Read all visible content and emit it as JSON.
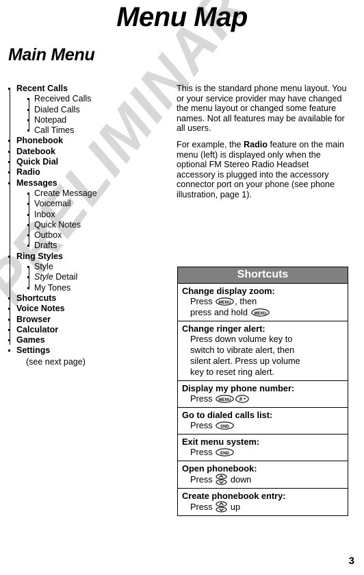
{
  "document": {
    "title": "Menu Map",
    "section_title": "Main Menu",
    "watermark": "PRELIMINARY",
    "page_number": "3"
  },
  "menu_tree": {
    "items": [
      {
        "label": "Recent Calls",
        "children": [
          {
            "label": "Received Calls"
          },
          {
            "label": "Dialed Calls"
          },
          {
            "label": "Notepad"
          },
          {
            "label": "Call Times"
          }
        ]
      },
      {
        "label": "Phonebook",
        "children": []
      },
      {
        "label": "Datebook",
        "children": []
      },
      {
        "label": "Quick Dial",
        "children": []
      },
      {
        "label": "Radio",
        "children": []
      },
      {
        "label": "Messages",
        "children": [
          {
            "label": "Create Message"
          },
          {
            "label": "Voicemail"
          },
          {
            "label": "Inbox"
          },
          {
            "label": "Quick Notes"
          },
          {
            "label": "Outbox"
          },
          {
            "label": "Drafts"
          }
        ]
      },
      {
        "label": "Ring Styles",
        "children": [
          {
            "label": "Style"
          },
          {
            "label": "Style Detail",
            "italic_prefix": "Style",
            "rest": " Detail"
          },
          {
            "label": "My Tones"
          }
        ]
      },
      {
        "label": "Shortcuts",
        "children": []
      },
      {
        "label": "Voice Notes",
        "children": []
      },
      {
        "label": "Browser",
        "children": []
      },
      {
        "label": "Calculator",
        "children": []
      },
      {
        "label": "Games",
        "children": []
      },
      {
        "label": "Settings",
        "children": []
      }
    ],
    "note": "(see next page)"
  },
  "body": {
    "paragraph1": "This is the standard phone menu layout. You or your service provider may have changed the menu layout or changed some feature names. Not all features may be available for all users.",
    "paragraph2_before": "For example, the ",
    "paragraph2_bold": "Radio",
    "paragraph2_after": " feature on the main menu (left) is displayed only when the optional FM Stereo Radio Headset accessory is plugged into the accessory connector port on your phone (see phone illustration, page 1)."
  },
  "shortcuts": {
    "header": "Shortcuts",
    "header_bg": "#808080",
    "header_text_color": "#ffffff",
    "rows": [
      {
        "title": "Change display zoom:",
        "lines": [
          {
            "pre": "Press ",
            "key": "menu-key",
            "post": ", then"
          },
          {
            "pre": "press and hold ",
            "key": "menu-key",
            "post": ""
          }
        ]
      },
      {
        "title": "Change ringer alert:",
        "lines": [
          {
            "pre": "Press down volume key to",
            "key": "",
            "post": ""
          },
          {
            "pre": "switch to vibrate alert, then",
            "key": "",
            "post": ""
          },
          {
            "pre": "silent alert. Press up volume",
            "key": "",
            "post": ""
          },
          {
            "pre": "key to reset ring alert.",
            "key": "",
            "post": ""
          }
        ]
      },
      {
        "title": "Display my phone number:",
        "lines": [
          {
            "pre": "Press ",
            "key": "menu-key",
            "key2": "pound-key",
            "post": ""
          }
        ]
      },
      {
        "title": "Go to dialed calls list:",
        "lines": [
          {
            "pre": "Press ",
            "key": "send-key",
            "post": ""
          }
        ]
      },
      {
        "title": "Exit menu system:",
        "lines": [
          {
            "pre": "Press ",
            "key": "end-key",
            "post": ""
          }
        ]
      },
      {
        "title": "Open phonebook:",
        "lines": [
          {
            "pre": "Press ",
            "key": "nav-key",
            "post": " down"
          }
        ]
      },
      {
        "title": "Create phonebook entry:",
        "lines": [
          {
            "pre": "Press ",
            "key": "nav-key",
            "post": " up"
          }
        ]
      }
    ]
  },
  "key_glyphs": {
    "menu-key": "MENU",
    "pound-key": "#",
    "send-key": "SND",
    "end-key": "END",
    "nav-key": "nav-up-down"
  }
}
